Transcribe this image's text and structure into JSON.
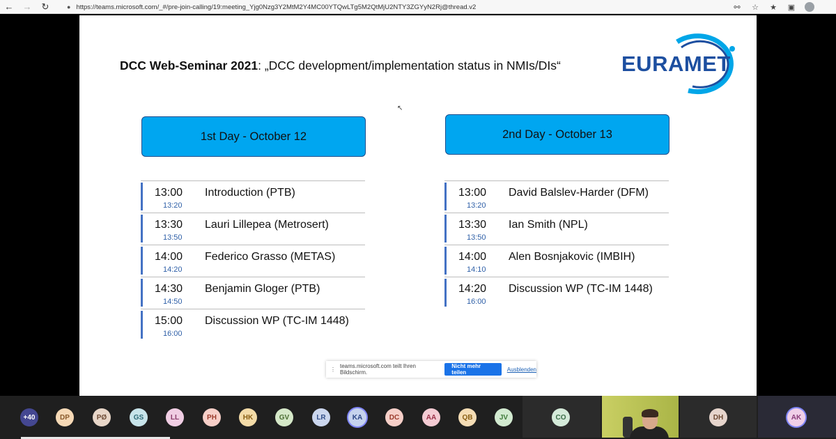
{
  "browser": {
    "back_icon": "←",
    "forward_icon": "→",
    "reload_icon": "↻",
    "lock_icon": "🔒",
    "url": "https://teams.microsoft.com/_#/pre-join-calling/19:meeting_Yjg0Nzg3Y2MtM2Y4MC00YTQwLTg5M2QtMjU2NTY3ZGYyN2Rj@thread.v2",
    "icons": [
      "microphone-icon",
      "star-icon",
      "favorites-icon",
      "collections-icon",
      "profile-icon"
    ]
  },
  "slide": {
    "title_bold": "DCC Web-Seminar 2021",
    "title_rest": ": „DCC development/implementation status in NMIs/DIs“",
    "logo_text": "EURAMET",
    "day1": {
      "label": "1st Day - October 12",
      "rows": [
        {
          "start": "13:00",
          "end": "13:20",
          "speaker": "Introduction (PTB)"
        },
        {
          "start": "13:30",
          "end": "13:50",
          "speaker": "Lauri Lillepea (Metrosert)"
        },
        {
          "start": "14:00",
          "end": "14:20",
          "speaker": "Federico Grasso (METAS)"
        },
        {
          "start": "14:30",
          "end": "14:50",
          "speaker": "Benjamin Gloger (PTB)"
        },
        {
          "start": "15:00",
          "end": "16:00",
          "speaker": "Discussion WP (TC-IM 1448)"
        }
      ]
    },
    "day2": {
      "label": "2nd Day - October 13",
      "rows": [
        {
          "start": "13:00",
          "end": "13:20",
          "speaker": "David Balslev-Harder (DFM)"
        },
        {
          "start": "13:30",
          "end": "13:50",
          "speaker": "Ian Smith (NPL)"
        },
        {
          "start": "14:00",
          "end": "14:10",
          "speaker": "Alen Bosnjakovic (IMBIH)"
        },
        {
          "start": "14:20",
          "end": "16:00",
          "speaker": "Discussion WP (TC-IM 1448)"
        }
      ]
    }
  },
  "share_bar": {
    "message": "teams.microsoft.com teilt Ihren Bildschirm.",
    "stop_label": "Nicht mehr teilen",
    "hide_label": "Ausblenden"
  },
  "participants": {
    "more_label": "+40",
    "avatars": [
      {
        "initials": "DP",
        "bg": "#f6d9b6",
        "fg": "#8a5a2b"
      },
      {
        "initials": "PØ",
        "bg": "#e8d6c8",
        "fg": "#6e4b35"
      },
      {
        "initials": "GS",
        "bg": "#c8e4ea",
        "fg": "#2f6b78"
      },
      {
        "initials": "LL",
        "bg": "#f0cde3",
        "fg": "#8a3d6b"
      },
      {
        "initials": "PH",
        "bg": "#f7cfc8",
        "fg": "#9b3b2c"
      },
      {
        "initials": "HK",
        "bg": "#f3dba7",
        "fg": "#8a5f14"
      },
      {
        "initials": "GV",
        "bg": "#d5e8c8",
        "fg": "#4b6e33"
      },
      {
        "initials": "LR",
        "bg": "#cbd6ee",
        "fg": "#34508a"
      },
      {
        "initials": "KA",
        "bg": "#c6d3ee",
        "fg": "#2b4585"
      },
      {
        "initials": "DC",
        "bg": "#f6cfc8",
        "fg": "#9b3b2c"
      },
      {
        "initials": "AA",
        "bg": "#f4cbd3",
        "fg": "#9b2f47"
      },
      {
        "initials": "QB",
        "bg": "#f4dcb4",
        "fg": "#8a5f14"
      },
      {
        "initials": "JV",
        "bg": "#d2ead0",
        "fg": "#3f7a3a"
      },
      {
        "initials": "CO",
        "bg": "#d4ead9",
        "fg": "#3b6e48"
      },
      {
        "initials": "DH",
        "bg": "#e6d5cc",
        "fg": "#6e4b35"
      },
      {
        "initials": "AK",
        "bg": "#f0cfe8",
        "fg": "#8a3d7b"
      }
    ]
  }
}
